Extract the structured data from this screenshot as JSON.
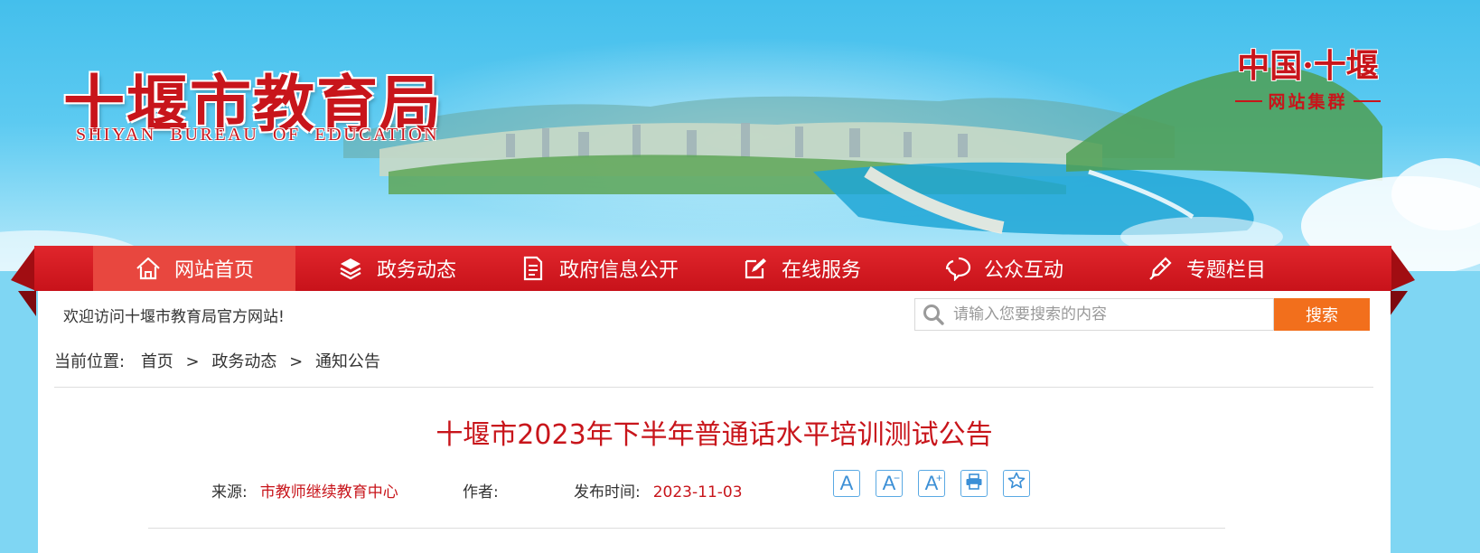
{
  "header": {
    "site_title_cn": "十堰市教育局",
    "site_title_en": "SHIYAN BUREAU OF EDUCATION",
    "group_title": "中国·十堰",
    "group_subtitle": "网站集群"
  },
  "nav": {
    "items": [
      {
        "label": "网站首页",
        "icon": "home-icon",
        "active": true
      },
      {
        "label": "政务动态",
        "icon": "layers-icon",
        "active": false
      },
      {
        "label": "政府信息公开",
        "icon": "document-icon",
        "active": false
      },
      {
        "label": "在线服务",
        "icon": "edit-icon",
        "active": false
      },
      {
        "label": "公众互动",
        "icon": "chat-icon",
        "active": false
      },
      {
        "label": "专题栏目",
        "icon": "pen-icon",
        "active": false
      }
    ]
  },
  "topbar": {
    "welcome": "欢迎访问十堰市教育局官方网站!",
    "search_placeholder": "请输入您要搜索的内容",
    "search_button": "搜索"
  },
  "breadcrumb": {
    "label": "当前位置:",
    "items": [
      "首页",
      "政务动态",
      "通知公告"
    ],
    "separator": ">"
  },
  "article": {
    "title": "十堰市2023年下半年普通话水平培训测试公告",
    "source_label": "来源:",
    "source_value": "市教师继续教育中心",
    "author_label": "作者:",
    "author_value": "",
    "date_label": "发布时间:",
    "date_value": "2023-11-03"
  },
  "tools": {
    "font_default": "A",
    "font_smaller": "A",
    "font_smaller_mark": "−",
    "font_larger": "A",
    "font_larger_mark": "+"
  },
  "colors": {
    "brand_red": "#c8151b",
    "nav_active": "#e8473f",
    "search_button": "#f26f1c",
    "tool_blue": "#3b8fd6"
  }
}
